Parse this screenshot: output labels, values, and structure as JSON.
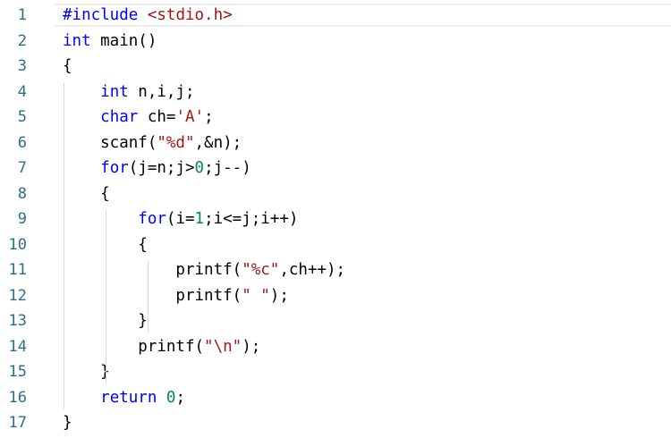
{
  "editor": {
    "lines": [
      {
        "n": "1",
        "tokens": [
          {
            "t": "#include",
            "c": "pp"
          },
          {
            "t": " ",
            "c": "id"
          },
          {
            "t": "<stdio.h>",
            "c": "inc"
          }
        ]
      },
      {
        "n": "2",
        "tokens": [
          {
            "t": "int",
            "c": "kw"
          },
          {
            "t": " main()",
            "c": "id"
          }
        ]
      },
      {
        "n": "3",
        "tokens": [
          {
            "t": "{",
            "c": "id"
          }
        ]
      },
      {
        "n": "4",
        "tokens": [
          {
            "t": "    ",
            "c": "id"
          },
          {
            "t": "int",
            "c": "kw"
          },
          {
            "t": " n,i,j;",
            "c": "id"
          }
        ]
      },
      {
        "n": "5",
        "tokens": [
          {
            "t": "    ",
            "c": "id"
          },
          {
            "t": "char",
            "c": "kw"
          },
          {
            "t": " ch=",
            "c": "id"
          },
          {
            "t": "'A'",
            "c": "str"
          },
          {
            "t": ";",
            "c": "id"
          }
        ]
      },
      {
        "n": "6",
        "tokens": [
          {
            "t": "    scanf(",
            "c": "id"
          },
          {
            "t": "\"%d\"",
            "c": "str"
          },
          {
            "t": ",&n);",
            "c": "id"
          }
        ]
      },
      {
        "n": "7",
        "tokens": [
          {
            "t": "    ",
            "c": "id"
          },
          {
            "t": "for",
            "c": "kw"
          },
          {
            "t": "(j=n;j>",
            "c": "id"
          },
          {
            "t": "0",
            "c": "num"
          },
          {
            "t": ";j--)",
            "c": "id"
          }
        ]
      },
      {
        "n": "8",
        "tokens": [
          {
            "t": "    {",
            "c": "id"
          }
        ]
      },
      {
        "n": "9",
        "tokens": [
          {
            "t": "        ",
            "c": "id"
          },
          {
            "t": "for",
            "c": "kw"
          },
          {
            "t": "(i=",
            "c": "id"
          },
          {
            "t": "1",
            "c": "num"
          },
          {
            "t": ";i<=j;i++)",
            "c": "id"
          }
        ]
      },
      {
        "n": "10",
        "tokens": [
          {
            "t": "        {",
            "c": "id"
          }
        ]
      },
      {
        "n": "11",
        "tokens": [
          {
            "t": "            printf(",
            "c": "id"
          },
          {
            "t": "\"%c\"",
            "c": "str"
          },
          {
            "t": ",ch++);",
            "c": "id"
          }
        ]
      },
      {
        "n": "12",
        "tokens": [
          {
            "t": "            printf(",
            "c": "id"
          },
          {
            "t": "\" \"",
            "c": "str"
          },
          {
            "t": ");",
            "c": "id"
          }
        ]
      },
      {
        "n": "13",
        "tokens": [
          {
            "t": "        }",
            "c": "id"
          }
        ]
      },
      {
        "n": "14",
        "tokens": [
          {
            "t": "        printf(",
            "c": "id"
          },
          {
            "t": "\"\\n\"",
            "c": "str"
          },
          {
            "t": ");",
            "c": "id"
          }
        ]
      },
      {
        "n": "15",
        "tokens": [
          {
            "t": "    }",
            "c": "id"
          }
        ]
      },
      {
        "n": "16",
        "tokens": [
          {
            "t": "    ",
            "c": "id"
          },
          {
            "t": "return",
            "c": "kw"
          },
          {
            "t": " ",
            "c": "id"
          },
          {
            "t": "0",
            "c": "num"
          },
          {
            "t": ";",
            "c": "id"
          }
        ]
      },
      {
        "n": "17",
        "tokens": [
          {
            "t": "}",
            "c": "id"
          }
        ]
      }
    ],
    "colors": {
      "keyword": "#0000ff",
      "string": "#a31515",
      "number": "#098658",
      "line_number": "#2b6f8c",
      "text": "#000000"
    }
  }
}
